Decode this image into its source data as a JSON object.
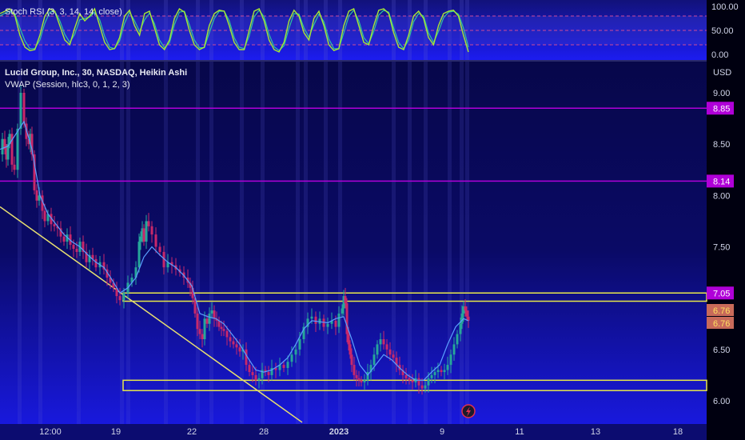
{
  "chart_data": {
    "type": "line",
    "title": "Lucid Group, Inc., 30, NASDAQ, Heikin Ashi",
    "indicator_label": "VWAP (Session, hlc3, 0, 1, 2, 3)",
    "currency": "USD",
    "y_ticks": [
      "9.00",
      "8.50",
      "8.00",
      "7.50",
      "6.50",
      "6.00"
    ],
    "x_ticks": [
      "12:00",
      "19",
      "22",
      "28",
      "2023",
      "9",
      "11",
      "13",
      "18"
    ],
    "ylim": [
      5.95,
      9.25
    ],
    "price_series": {
      "name": "Heikin Ashi close",
      "x": [
        0,
        3,
        6,
        8,
        10,
        12,
        15,
        18,
        22,
        26,
        30,
        33,
        36,
        38,
        40,
        43,
        46,
        49,
        53,
        56,
        60,
        64,
        68,
        72,
        76,
        80,
        84,
        88,
        92,
        96,
        100,
        104,
        108,
        112,
        116,
        120,
        125,
        130,
        134,
        138,
        142,
        146,
        150,
        155,
        160,
        165,
        170,
        174,
        176,
        178,
        180,
        183,
        186,
        190,
        195,
        200,
        205,
        210,
        215,
        220,
        225,
        230,
        235,
        238,
        241,
        244,
        247,
        250,
        253,
        256,
        259,
        262,
        265,
        268,
        271,
        274,
        277,
        280,
        284,
        288,
        292,
        296,
        300,
        304,
        308,
        312,
        316,
        320,
        324,
        328,
        332,
        336,
        340,
        345,
        350,
        355,
        360,
        365,
        370,
        375,
        380,
        385,
        390,
        395,
        400,
        405,
        410,
        415,
        420,
        424,
        428,
        430,
        432,
        434,
        436,
        438,
        440,
        443,
        446,
        449,
        452,
        456,
        460,
        464,
        468,
        472,
        476,
        480,
        484,
        488,
        492,
        496,
        500,
        504,
        508,
        512,
        516,
        520,
        524,
        528,
        532,
        536,
        540,
        544,
        548,
        552,
        556,
        560,
        564,
        568,
        572,
        576,
        578,
        580,
        582,
        584,
        586
      ],
      "values": [
        8.4,
        8.55,
        8.45,
        8.35,
        8.5,
        8.6,
        8.3,
        8.25,
        8.65,
        9.0,
        8.7,
        8.55,
        8.5,
        8.6,
        8.4,
        8.05,
        7.95,
        8.0,
        7.85,
        7.75,
        7.82,
        7.72,
        7.7,
        7.68,
        7.6,
        7.55,
        7.62,
        7.52,
        7.48,
        7.45,
        7.55,
        7.45,
        7.35,
        7.42,
        7.38,
        7.3,
        7.35,
        7.28,
        7.2,
        7.15,
        7.1,
        7.02,
        6.98,
        7.05,
        7.15,
        7.2,
        7.3,
        7.55,
        7.6,
        7.68,
        7.55,
        7.75,
        7.7,
        7.62,
        7.5,
        7.45,
        7.3,
        7.35,
        7.32,
        7.28,
        7.25,
        7.2,
        7.15,
        7.1,
        7.0,
        6.85,
        6.7,
        6.65,
        6.6,
        6.8,
        6.75,
        6.85,
        6.88,
        6.8,
        6.78,
        6.72,
        6.7,
        6.68,
        6.62,
        6.58,
        6.55,
        6.52,
        6.48,
        6.5,
        6.35,
        6.28,
        6.25,
        6.2,
        6.22,
        6.3,
        6.28,
        6.25,
        6.32,
        6.3,
        6.35,
        6.32,
        6.38,
        6.45,
        6.5,
        6.6,
        6.72,
        6.8,
        6.82,
        6.75,
        6.8,
        6.72,
        6.75,
        6.78,
        6.72,
        6.85,
        6.9,
        7.02,
        6.95,
        6.65,
        6.55,
        6.45,
        6.35,
        6.25,
        6.22,
        6.2,
        6.18,
        6.2,
        6.28,
        6.35,
        6.45,
        6.55,
        6.6,
        6.55,
        6.5,
        6.45,
        6.42,
        6.35,
        6.3,
        6.25,
        6.22,
        6.2,
        6.18,
        6.22,
        6.15,
        6.12,
        6.15,
        6.22,
        6.25,
        6.28,
        6.3,
        6.28,
        6.3,
        6.35,
        6.45,
        6.55,
        6.65,
        6.75,
        6.85,
        6.92,
        6.88,
        6.82,
        6.78
      ]
    },
    "vwap_series": {
      "x": [
        0,
        10,
        20,
        30,
        40,
        50,
        60,
        70,
        80,
        90,
        100,
        110,
        120,
        130,
        140,
        150,
        160,
        170,
        180,
        190,
        200,
        210,
        220,
        230,
        240,
        250,
        260,
        270,
        280,
        290,
        300,
        310,
        320,
        330,
        340,
        350,
        360,
        370,
        380,
        390,
        400,
        410,
        420,
        430,
        440,
        450,
        460,
        470,
        480,
        490,
        500,
        510,
        520,
        530,
        540,
        550,
        560,
        570,
        580,
        586
      ],
      "values": [
        8.45,
        8.48,
        8.6,
        8.72,
        8.45,
        8.0,
        7.82,
        7.72,
        7.62,
        7.55,
        7.5,
        7.42,
        7.35,
        7.3,
        7.18,
        7.05,
        7.1,
        7.2,
        7.4,
        7.5,
        7.42,
        7.35,
        7.3,
        7.22,
        7.12,
        6.85,
        6.82,
        6.8,
        6.75,
        6.65,
        6.55,
        6.42,
        6.3,
        6.28,
        6.3,
        6.35,
        6.42,
        6.55,
        6.7,
        6.78,
        6.77,
        6.76,
        6.8,
        6.82,
        6.6,
        6.35,
        6.25,
        6.35,
        6.45,
        6.4,
        6.32,
        6.25,
        6.2,
        6.2,
        6.28,
        6.35,
        6.55,
        6.72,
        6.8,
        6.78
      ]
    },
    "horizontal_levels": [
      {
        "label": "8.85",
        "value": 8.85,
        "color": "#b000d8"
      },
      {
        "label": "8.14",
        "value": 8.14,
        "color": "#b000d8"
      }
    ],
    "range_boxes": [
      {
        "label": "7.05",
        "top": 7.05,
        "bottom": 6.97,
        "x_start": 154,
        "color": "#e8e84a"
      },
      {
        "top": 6.2,
        "bottom": 6.1,
        "x_start": 154,
        "color": "#e8e84a"
      }
    ],
    "trendline": {
      "x1": 0,
      "y1": 7.89,
      "x2": 378,
      "y2": 5.79,
      "color": "#e8e070"
    },
    "price_tags": [
      {
        "label": "6.76",
        "color": "#c86a5a"
      },
      {
        "label": "6.76",
        "color": "#c86a5a"
      }
    ],
    "stoch_rsi": {
      "name": "Stoch RSI (3, 3, 14, 14, close)",
      "y_ticks": [
        "100.00",
        "50.00",
        "0.00"
      ],
      "bands": [
        80,
        50,
        20
      ],
      "k_series": [
        85,
        90,
        95,
        80,
        40,
        15,
        8,
        10,
        40,
        80,
        95,
        90,
        60,
        30,
        20,
        55,
        85,
        70,
        80,
        95,
        60,
        25,
        10,
        12,
        35,
        80,
        92,
        60,
        40,
        85,
        90,
        55,
        20,
        10,
        30,
        75,
        95,
        88,
        50,
        20,
        10,
        15,
        60,
        85,
        92,
        90,
        60,
        25,
        10,
        10,
        50,
        90,
        95,
        70,
        30,
        10,
        5,
        25,
        70,
        92,
        80,
        45,
        30,
        75,
        90,
        60,
        20,
        8,
        12,
        60,
        90,
        95,
        60,
        25,
        20,
        60,
        92,
        95,
        85,
        45,
        15,
        10,
        40,
        80,
        90,
        75,
        35,
        20,
        60,
        85,
        90,
        92,
        80,
        40,
        5
      ],
      "d_series": [
        80,
        86,
        90,
        84,
        55,
        28,
        12,
        12,
        30,
        65,
        88,
        90,
        70,
        42,
        25,
        42,
        72,
        75,
        78,
        88,
        72,
        38,
        15,
        12,
        28,
        65,
        88,
        70,
        48,
        72,
        86,
        64,
        30,
        14,
        24,
        62,
        88,
        90,
        62,
        30,
        14,
        14,
        45,
        75,
        90,
        90,
        70,
        35,
        15,
        12,
        38,
        78,
        92,
        78,
        42,
        16,
        8,
        18,
        55,
        85,
        84,
        55,
        36,
        62,
        84,
        68,
        32,
        12,
        12,
        45,
        80,
        92,
        70,
        35,
        22,
        48,
        82,
        92,
        88,
        55,
        25,
        12,
        30,
        68,
        85,
        80,
        45,
        25,
        48,
        76,
        88,
        90,
        84,
        55,
        15
      ]
    }
  },
  "colors": {
    "background": "#0a0a5a",
    "price_up": "#26a69a",
    "price_down": "#c8286a",
    "vwap": "#5aa0ff",
    "stoch_k": "#a8e832",
    "stoch_d": "#2ec4a0",
    "stoch_band": "#cc4a9a"
  },
  "icons": {
    "flash": "lightning-icon"
  }
}
